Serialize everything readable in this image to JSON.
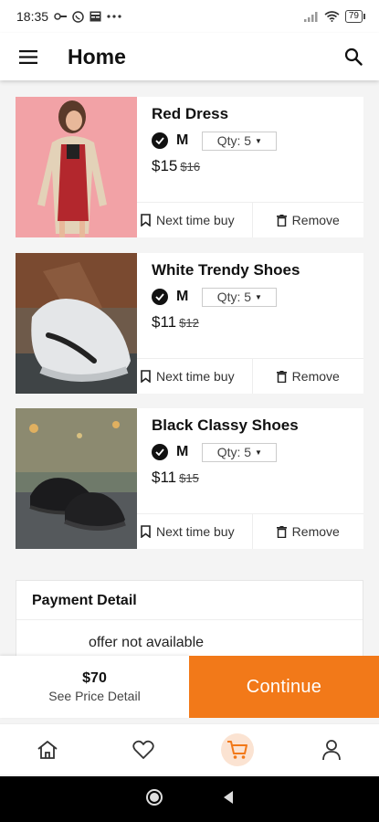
{
  "status_bar": {
    "time": "18:35",
    "battery": "79",
    "left_icons": [
      "signal-key-icon",
      "whatsapp-icon",
      "news-icon",
      "more-dots-icon"
    ],
    "right_icons": [
      "cell-signal-icon",
      "wifi-icon",
      "battery-icon"
    ]
  },
  "appbar": {
    "title": "Home",
    "menu_icon": "hamburger-menu-icon",
    "search_icon": "search-icon"
  },
  "cart_items": [
    {
      "name": "Red Dress",
      "size": "M",
      "qty_label": "Qty: 5",
      "price": "$15",
      "old_price": "$16",
      "save_label": "Next time buy",
      "remove_label": "Remove",
      "image": "woman in red dress and beige coat"
    },
    {
      "name": "White Trendy Shoes",
      "size": "M",
      "qty_label": "Qty: 5",
      "price": "$11",
      "old_price": "$12",
      "save_label": "Next time buy",
      "remove_label": "Remove",
      "image": "white sneaker on foot"
    },
    {
      "name": "Black Classy Shoes",
      "size": "M",
      "qty_label": "Qty: 5",
      "price": "$11",
      "old_price": "$15",
      "save_label": "Next time buy",
      "remove_label": "Remove",
      "image": "pair of black sneakers on road"
    }
  ],
  "payment": {
    "title": "Payment Detail",
    "offer_text": "offer not available"
  },
  "checkout": {
    "total": "$70",
    "see_detail": "See Price Detail",
    "continue_label": "Continue"
  },
  "bottom_nav": {
    "items": [
      "home-icon",
      "heart-icon",
      "cart-icon",
      "profile-icon"
    ],
    "active": "cart-icon"
  },
  "colors": {
    "accent": "#f27919",
    "accent_soft": "#fbe3d2",
    "background": "#f4f4f4"
  }
}
